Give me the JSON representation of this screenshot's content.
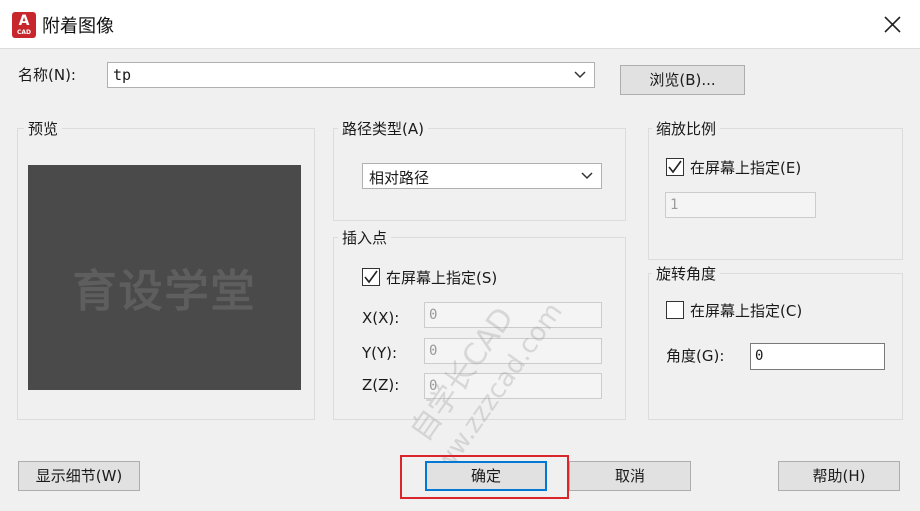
{
  "window": {
    "title": "附着图像",
    "icon_text": "A",
    "icon_subtext": "CAD",
    "close_icon": "close-icon"
  },
  "name_row": {
    "label": "名称(N):",
    "value": "tp",
    "browse_label": "浏览(B)..."
  },
  "preview": {
    "title": "预览",
    "watermark": "育设学堂"
  },
  "path_type": {
    "title": "路径类型(A)",
    "selected": "相对路径"
  },
  "insertion_point": {
    "title": "插入点",
    "specify_label": "在屏幕上指定(S)",
    "specify_checked": true,
    "x_label": "X(X):",
    "x_value": "0",
    "y_label": "Y(Y):",
    "y_value": "0",
    "z_label": "Z(Z):",
    "z_value": "0"
  },
  "scale": {
    "title": "缩放比例",
    "specify_label": "在屏幕上指定(E)",
    "specify_checked": true,
    "value": "1"
  },
  "rotation": {
    "title": "旋转角度",
    "specify_label": "在屏幕上指定(C)",
    "specify_checked": false,
    "angle_label": "角度(G):",
    "angle_value": "0"
  },
  "watermarks": {
    "line1": "自学长CAD",
    "line2": "www.zzzcad.com"
  },
  "buttons": {
    "details": "显示细节(W)",
    "ok": "确定",
    "cancel": "取消",
    "help": "帮助(H)"
  },
  "colors": {
    "highlight": "#d9262b",
    "focus": "#0078d4",
    "brand": "#c8262d"
  }
}
